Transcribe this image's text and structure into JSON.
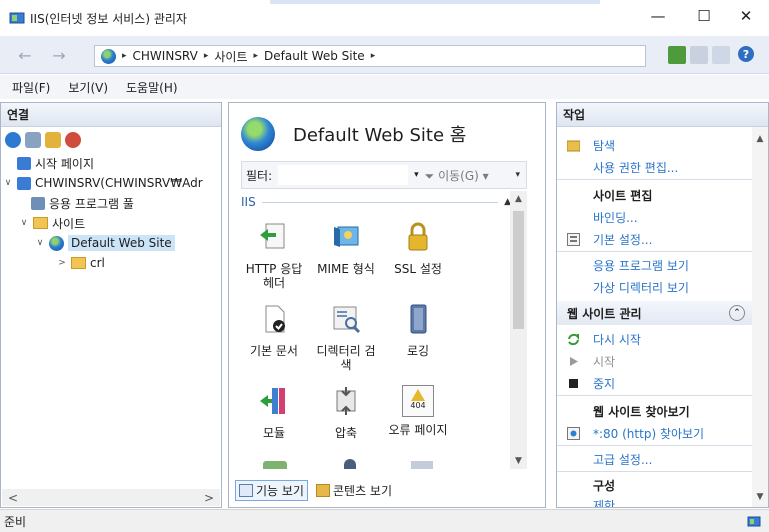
{
  "window": {
    "title": "IIS(인터넷 정보 서비스) 관리자",
    "minimize_glyph": "—",
    "maximize_glyph": "☐",
    "close_glyph": "✕"
  },
  "address": {
    "back_glyph": "←",
    "forward_glyph": "→",
    "sep": "▸",
    "crumbs": [
      "CHWINSRV",
      "사이트",
      "Default Web Site"
    ],
    "help_glyph": "?"
  },
  "menu": {
    "items": [
      "파일(F)",
      "보기(V)",
      "도움말(H)"
    ]
  },
  "connections": {
    "header": "연결",
    "tree": [
      {
        "label": "시작 페이지"
      },
      {
        "label": "CHWINSRV(CHWINSRV₩Adr",
        "expander": "∨"
      },
      {
        "label": "응용 프로그램 풀"
      },
      {
        "label": "사이트",
        "expander": "∨"
      },
      {
        "label": "Default Web Site",
        "expander": "∨"
      },
      {
        "label": "crl",
        "expander": ">"
      }
    ],
    "scroll_left": "<",
    "scroll_right": ">"
  },
  "center": {
    "heading": "Default Web Site 홈",
    "filter_label": "필터:",
    "filter_go": "▾ 🝖 이동(G) ▾",
    "go_label": "이동(G)",
    "group_label": "IIS",
    "features": [
      {
        "label": "HTTP 응답 헤더"
      },
      {
        "label": "MIME 형식"
      },
      {
        "label": "SSL 설정"
      },
      {
        "label": "기본 문서"
      },
      {
        "label": "디렉터리 검색"
      },
      {
        "label": "로깅"
      },
      {
        "label": "모듈"
      },
      {
        "label": "압축"
      },
      {
        "label": "오류 페이지"
      }
    ],
    "error_icon_text": "404",
    "view_tabs": [
      "기능 보기",
      "콘텐츠 보기"
    ]
  },
  "actions": {
    "header": "작업",
    "explore": "탐색",
    "edit_permissions": "사용 권한 편집...",
    "edit_site_header": "사이트 편집",
    "bindings": "바인딩...",
    "basic_settings": "기본 설정...",
    "view_apps": "응용 프로그램 보기",
    "view_vdirs": "가상 디렉터리 보기",
    "manage_header": "웹 사이트 관리",
    "collapse_glyph": "⌃",
    "restart": "다시 시작",
    "start": "시작",
    "stop": "중지",
    "browse_header": "웹 사이트 찾아보기",
    "browse_80": "*:80 (http) 찾아보기",
    "advanced": "고급 설정...",
    "config_header": "구성",
    "limits": "제한..."
  },
  "status": {
    "text": "준비"
  },
  "colors": {
    "link": "#2a74c9",
    "selection": "#cce4f7",
    "pane_border": "#a9b6c9"
  }
}
